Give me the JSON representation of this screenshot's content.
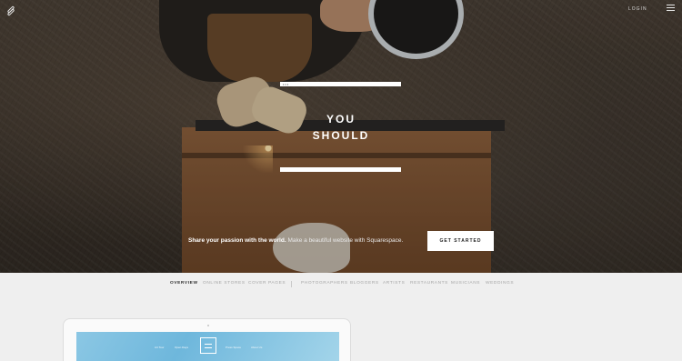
{
  "header": {
    "logo_icon": "squarespace-logo-icon",
    "login_label": "LOGIN",
    "menu_icon": "hamburger-menu-icon"
  },
  "hero": {
    "title_line1": "YOU",
    "title_line2": "SHOULD",
    "top_bar_dots": "•••",
    "tagline_strong": "Share your passion with the world.",
    "tagline_rest": " Make a beautiful website with Squarespace.",
    "cta_label": "GET STARTED"
  },
  "tabs": {
    "items": [
      {
        "label": "OVERVIEW",
        "active": true
      },
      {
        "label": "ONLINE STORES",
        "active": false
      },
      {
        "label": "COVER PAGES",
        "active": false
      },
      {
        "label": "PHOTOGRAPHERS",
        "active": false
      },
      {
        "label": "BLOGGERS",
        "active": false
      },
      {
        "label": "ARTISTS",
        "active": false
      },
      {
        "label": "RESTAURANTS",
        "active": false
      },
      {
        "label": "MUSICIANS",
        "active": false
      },
      {
        "label": "WEDDINGS",
        "active": false
      }
    ]
  },
  "preview": {
    "nav": [
      "Art Tour",
      "Open Days",
      "Press Space",
      "About Us"
    ]
  },
  "colors": {
    "page_bg": "#efefef",
    "cta_bg": "#ffffff",
    "active_tab": "#333333",
    "inactive_tab": "#a5a5a5"
  }
}
